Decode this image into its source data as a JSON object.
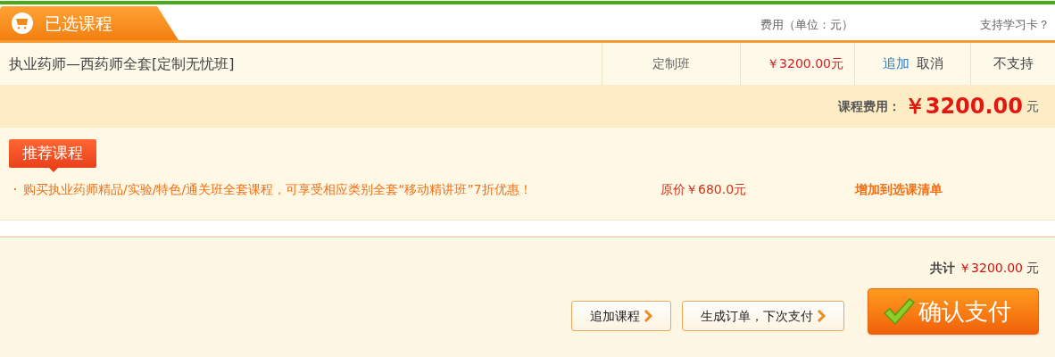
{
  "header": {
    "tab_title": "已选课程",
    "columns": [
      "费用（单位：元）",
      "支持学习卡？"
    ]
  },
  "course": {
    "name": "执业药师—西药师全套[定制无忧班]",
    "type": "定制班",
    "price": "￥3200.00元",
    "actions": [
      {
        "label": "追加",
        "kind": "link"
      },
      {
        "label": "取消",
        "kind": "plain"
      }
    ],
    "card_support": "不支持"
  },
  "fee": {
    "label": "课程费用：",
    "amount": "￥3200.00",
    "unit": "元"
  },
  "recommend": {
    "badge": "推荐课程",
    "items": [
      {
        "text": "购买执业药师精品/实验/特色/通关班全套课程，可享受相应类别全套“移动精讲班”7折优惠！",
        "original_price": "原价￥680.0元",
        "action": "增加到选课清单"
      }
    ]
  },
  "summary": {
    "label": "共计",
    "amount": "￥3200.00",
    "unit": "元"
  },
  "buttons": [
    {
      "label": "追加课程",
      "kind": "secondary"
    },
    {
      "label": "生成订单，下次支付",
      "kind": "secondary"
    },
    {
      "label": "确认支付",
      "kind": "primary"
    }
  ]
}
